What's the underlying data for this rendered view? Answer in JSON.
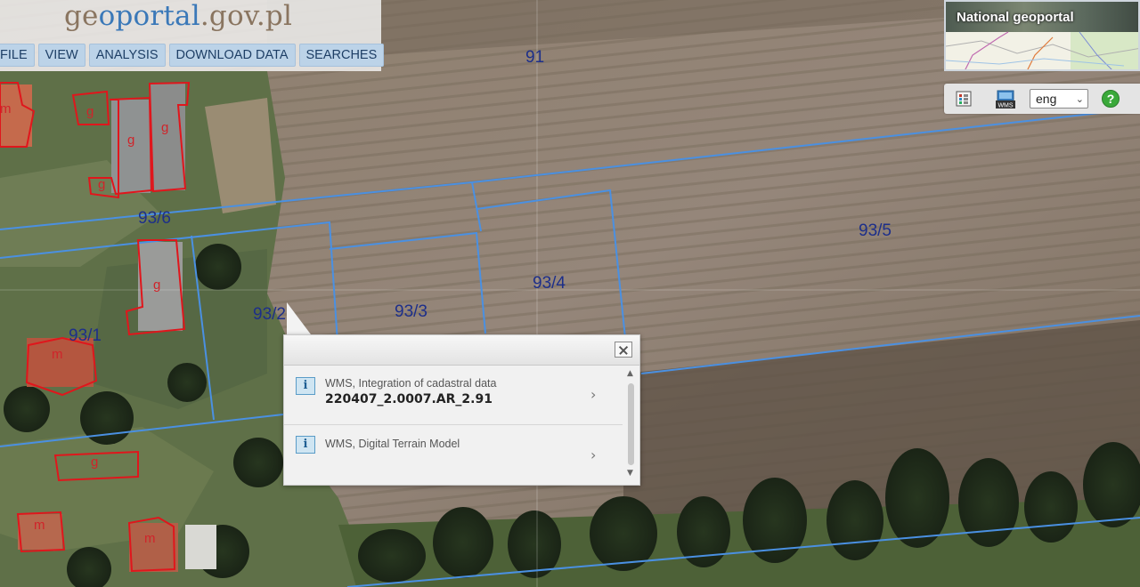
{
  "header": {
    "logo_prefix": "ge",
    "logo_o": "o",
    "logo_portal": "portal",
    "logo_suffix": ".gov.pl"
  },
  "menu": {
    "items": [
      "FILE",
      "VIEW",
      "ANALYSIS",
      "DOWNLOAD DATA",
      "SEARCHES"
    ]
  },
  "overview": {
    "title": "National geoportal"
  },
  "toolbar": {
    "language": "eng",
    "help_label": "?",
    "legend_icon": "legend-grid-icon",
    "wms_icon": "wms-icon"
  },
  "map": {
    "parcel_labels": [
      "91",
      "93/6",
      "93/5",
      "93/4",
      "93/3",
      "93/2",
      "93/1"
    ],
    "building_labels": [
      "m",
      "g",
      "g",
      "g",
      "g",
      "g",
      "m",
      "g",
      "m",
      "m"
    ],
    "parcel_line_color": "#4a90e2",
    "building_line_color": "#e0161c"
  },
  "popup": {
    "results": [
      {
        "source": "WMS, Integration of cadastral data",
        "value": "220407_2.0007.AR_2.91"
      },
      {
        "source": "WMS, Digital Terrain Model",
        "value": ""
      }
    ],
    "info_icon_label": "i",
    "chevron": "›"
  }
}
